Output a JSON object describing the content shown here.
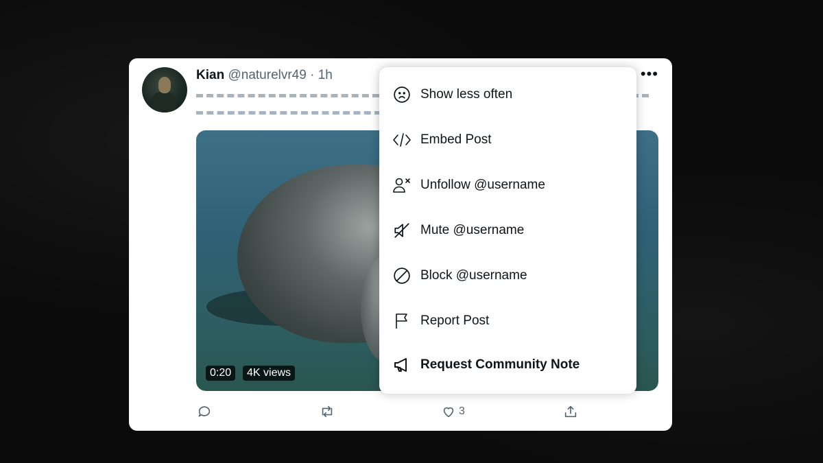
{
  "post": {
    "author_name": "Kian",
    "handle": "@naturelvr49",
    "separator": "·",
    "time": "1h",
    "more_label": "•••",
    "media": {
      "duration": "0:20",
      "views": "4K views"
    },
    "actions": {
      "likes_count": "3"
    }
  },
  "menu": {
    "items": [
      {
        "label": "Show less often",
        "icon": "frown-face-icon"
      },
      {
        "label": "Embed Post",
        "icon": "code-icon"
      },
      {
        "label": "Unfollow @username",
        "icon": "user-remove-icon"
      },
      {
        "label": "Mute @username",
        "icon": "mute-icon"
      },
      {
        "label": "Block @username",
        "icon": "block-icon"
      },
      {
        "label": "Report Post",
        "icon": "flag-icon"
      },
      {
        "label": "Request Community Note",
        "icon": "megaphone-icon"
      }
    ]
  },
  "colors": {
    "text_primary": "#0f1419",
    "text_secondary": "#536471",
    "placeholder_line": "#a7b3bd"
  }
}
